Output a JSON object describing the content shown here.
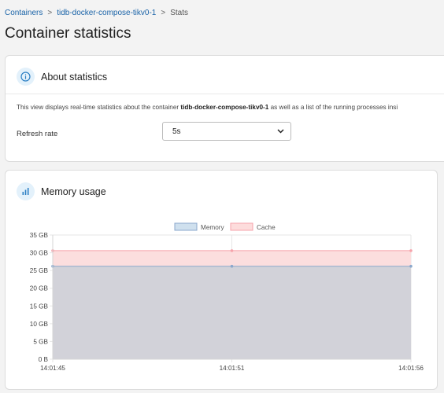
{
  "breadcrumb": {
    "items": [
      "Containers",
      "tidb-docker-compose-tikv0-1"
    ],
    "separator": ">",
    "current": "Stats"
  },
  "page": {
    "title": "Container statistics"
  },
  "about": {
    "title": "About statistics",
    "icon": "info-icon",
    "description_prefix": "This view displays real-time statistics about the container ",
    "container_name": "tidb-docker-compose-tikv0-1",
    "description_suffix": " as well as a list of the running processes insi",
    "refresh_label": "Refresh rate",
    "refresh_value": "5s"
  },
  "memory": {
    "title": "Memory usage",
    "icon": "bar-chart-icon"
  },
  "colors": {
    "memory_fill": "#d2d2d9",
    "memory_line": "#8ba8cc",
    "cache_fill": "#fcdede",
    "cache_line": "#f6a3ab",
    "legend_memory": "#cfe0ee",
    "legend_cache": "#fddcdc"
  },
  "chart_data": {
    "type": "area",
    "x": [
      "14:01:45",
      "14:01:51",
      "14:01:56"
    ],
    "series": [
      {
        "name": "Memory",
        "values": [
          26.2,
          26.2,
          26.2
        ]
      },
      {
        "name": "Cache",
        "values": [
          30.6,
          30.6,
          30.6
        ]
      }
    ],
    "yticks": [
      "35 GB",
      "30 GB",
      "25 GB",
      "20 GB",
      "15 GB",
      "10 GB",
      "5 GB",
      "0 B"
    ],
    "ylim": [
      0,
      35
    ],
    "legend_position": "top-center",
    "grid": true
  }
}
